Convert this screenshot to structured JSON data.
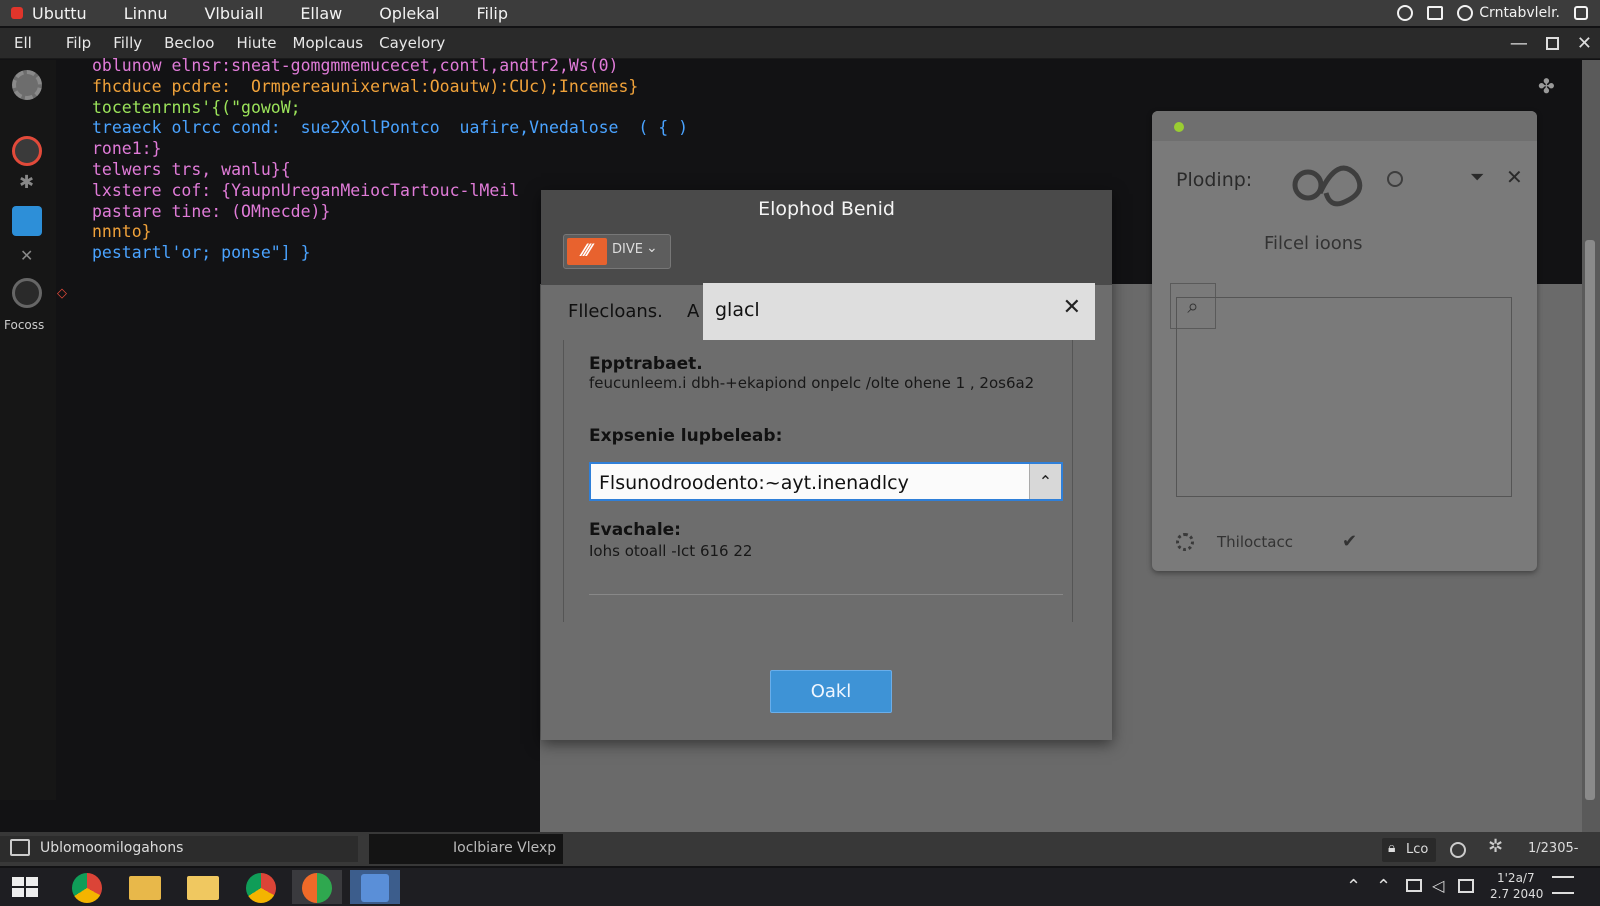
{
  "topbar": {
    "items": [
      "Ubuttu",
      "Linnu",
      "Vlbuiall",
      "Ellaw",
      "Oplekal",
      "Filip"
    ],
    "user_label": "Crntabvlelr."
  },
  "menubar": {
    "items": [
      "Ell",
      "Filp",
      "Filly",
      "Becloo",
      "Hiute",
      "Moplcaus",
      "Cayelory"
    ]
  },
  "rail": {
    "focus_label": "Focoss"
  },
  "editor": {
    "lines": [
      "oblunow elnsr:sneat-gomgmmemucecet,contl,andtr2,Ws(0)",
      "fhcduce pcdre:  Ormpereaunixerwal:Ooautw):CUc);Incemes}",
      "tocetenrnns'{(\"gowoW;",
      "treaeck olrcc cond:  sue2XollPontco  uafire,Vnedalose  ( { )",
      "rone1:}",
      "telwers trs, wanlu}{",
      "lxstere cof: {YaupnUreganMeiocTartouc-lMeil",
      "pastare tine: (OMnecde)}",
      "nnnto}",
      "pestartl'or; ponse\"] }"
    ]
  },
  "dialog": {
    "title": "Elophod Benid",
    "tag_label": "DIVE",
    "tab_label": "Fllecloans.",
    "tab_a": "A",
    "tab_input_value": "glacl",
    "field1_label": "Epptrabaet.",
    "field1_value": "feucunleem.i dbh-+ekapiond onpelc /olte ohene 1 , 2os6a2",
    "field2_label": "Expsenie lupbeleab:",
    "field2_value": "Flsunodroodento:~ayt.inenadlcy",
    "field3_label": "Evachale:",
    "field3_value": "Iohs otoall -Ict  616 22",
    "ok_label": "Oakl"
  },
  "rpanel": {
    "title": "Plodinp:",
    "subtitle": "Filcel ioons",
    "footer_label": "Thiloctacc"
  },
  "statusbar": {
    "left_label": "Ublomoomilogahons",
    "middle_label": "Ioclbiare Vlexp",
    "right_lock": "Lco",
    "right_time": "1/2305-"
  },
  "taskbar": {
    "clock_time": "1'2a/7",
    "clock_date": "2.7 2040"
  }
}
